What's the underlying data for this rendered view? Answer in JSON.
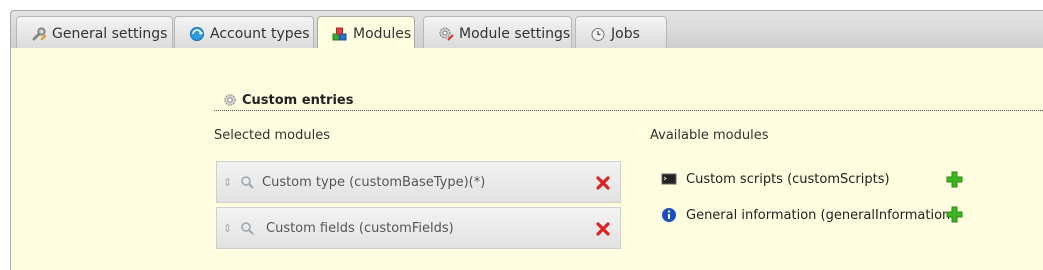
{
  "tabs": [
    {
      "label": "General settings",
      "icon": "wrench-icon"
    },
    {
      "label": "Account types",
      "icon": "account-types-icon"
    },
    {
      "label": "Modules",
      "icon": "modules-icon",
      "active": true
    },
    {
      "label": "Module settings",
      "icon": "module-settings-icon"
    },
    {
      "label": "Jobs",
      "icon": "clock-icon"
    }
  ],
  "section": {
    "title": "Custom entries",
    "icon": "gear-icon"
  },
  "selected": {
    "label": "Selected modules",
    "items": [
      {
        "name": "Custom type (customBaseType)(*)",
        "icon": "search-gear-icon",
        "remove_icon": "delete-icon"
      },
      {
        "name": "Custom fields (customFields)",
        "icon": "search-gear-icon",
        "remove_icon": "delete-icon"
      }
    ]
  },
  "available": {
    "label": "Available modules",
    "items": [
      {
        "name": "Custom scripts (customScripts)",
        "icon": "terminal-icon",
        "add_icon": "add-icon"
      },
      {
        "name": "General information (generalInformation)",
        "icon": "info-icon",
        "add_icon": "add-icon"
      }
    ]
  },
  "colors": {
    "panel_background": "#fffde0",
    "remove": "#e02020",
    "add": "#3cb521",
    "info": "#1c4fbf"
  }
}
